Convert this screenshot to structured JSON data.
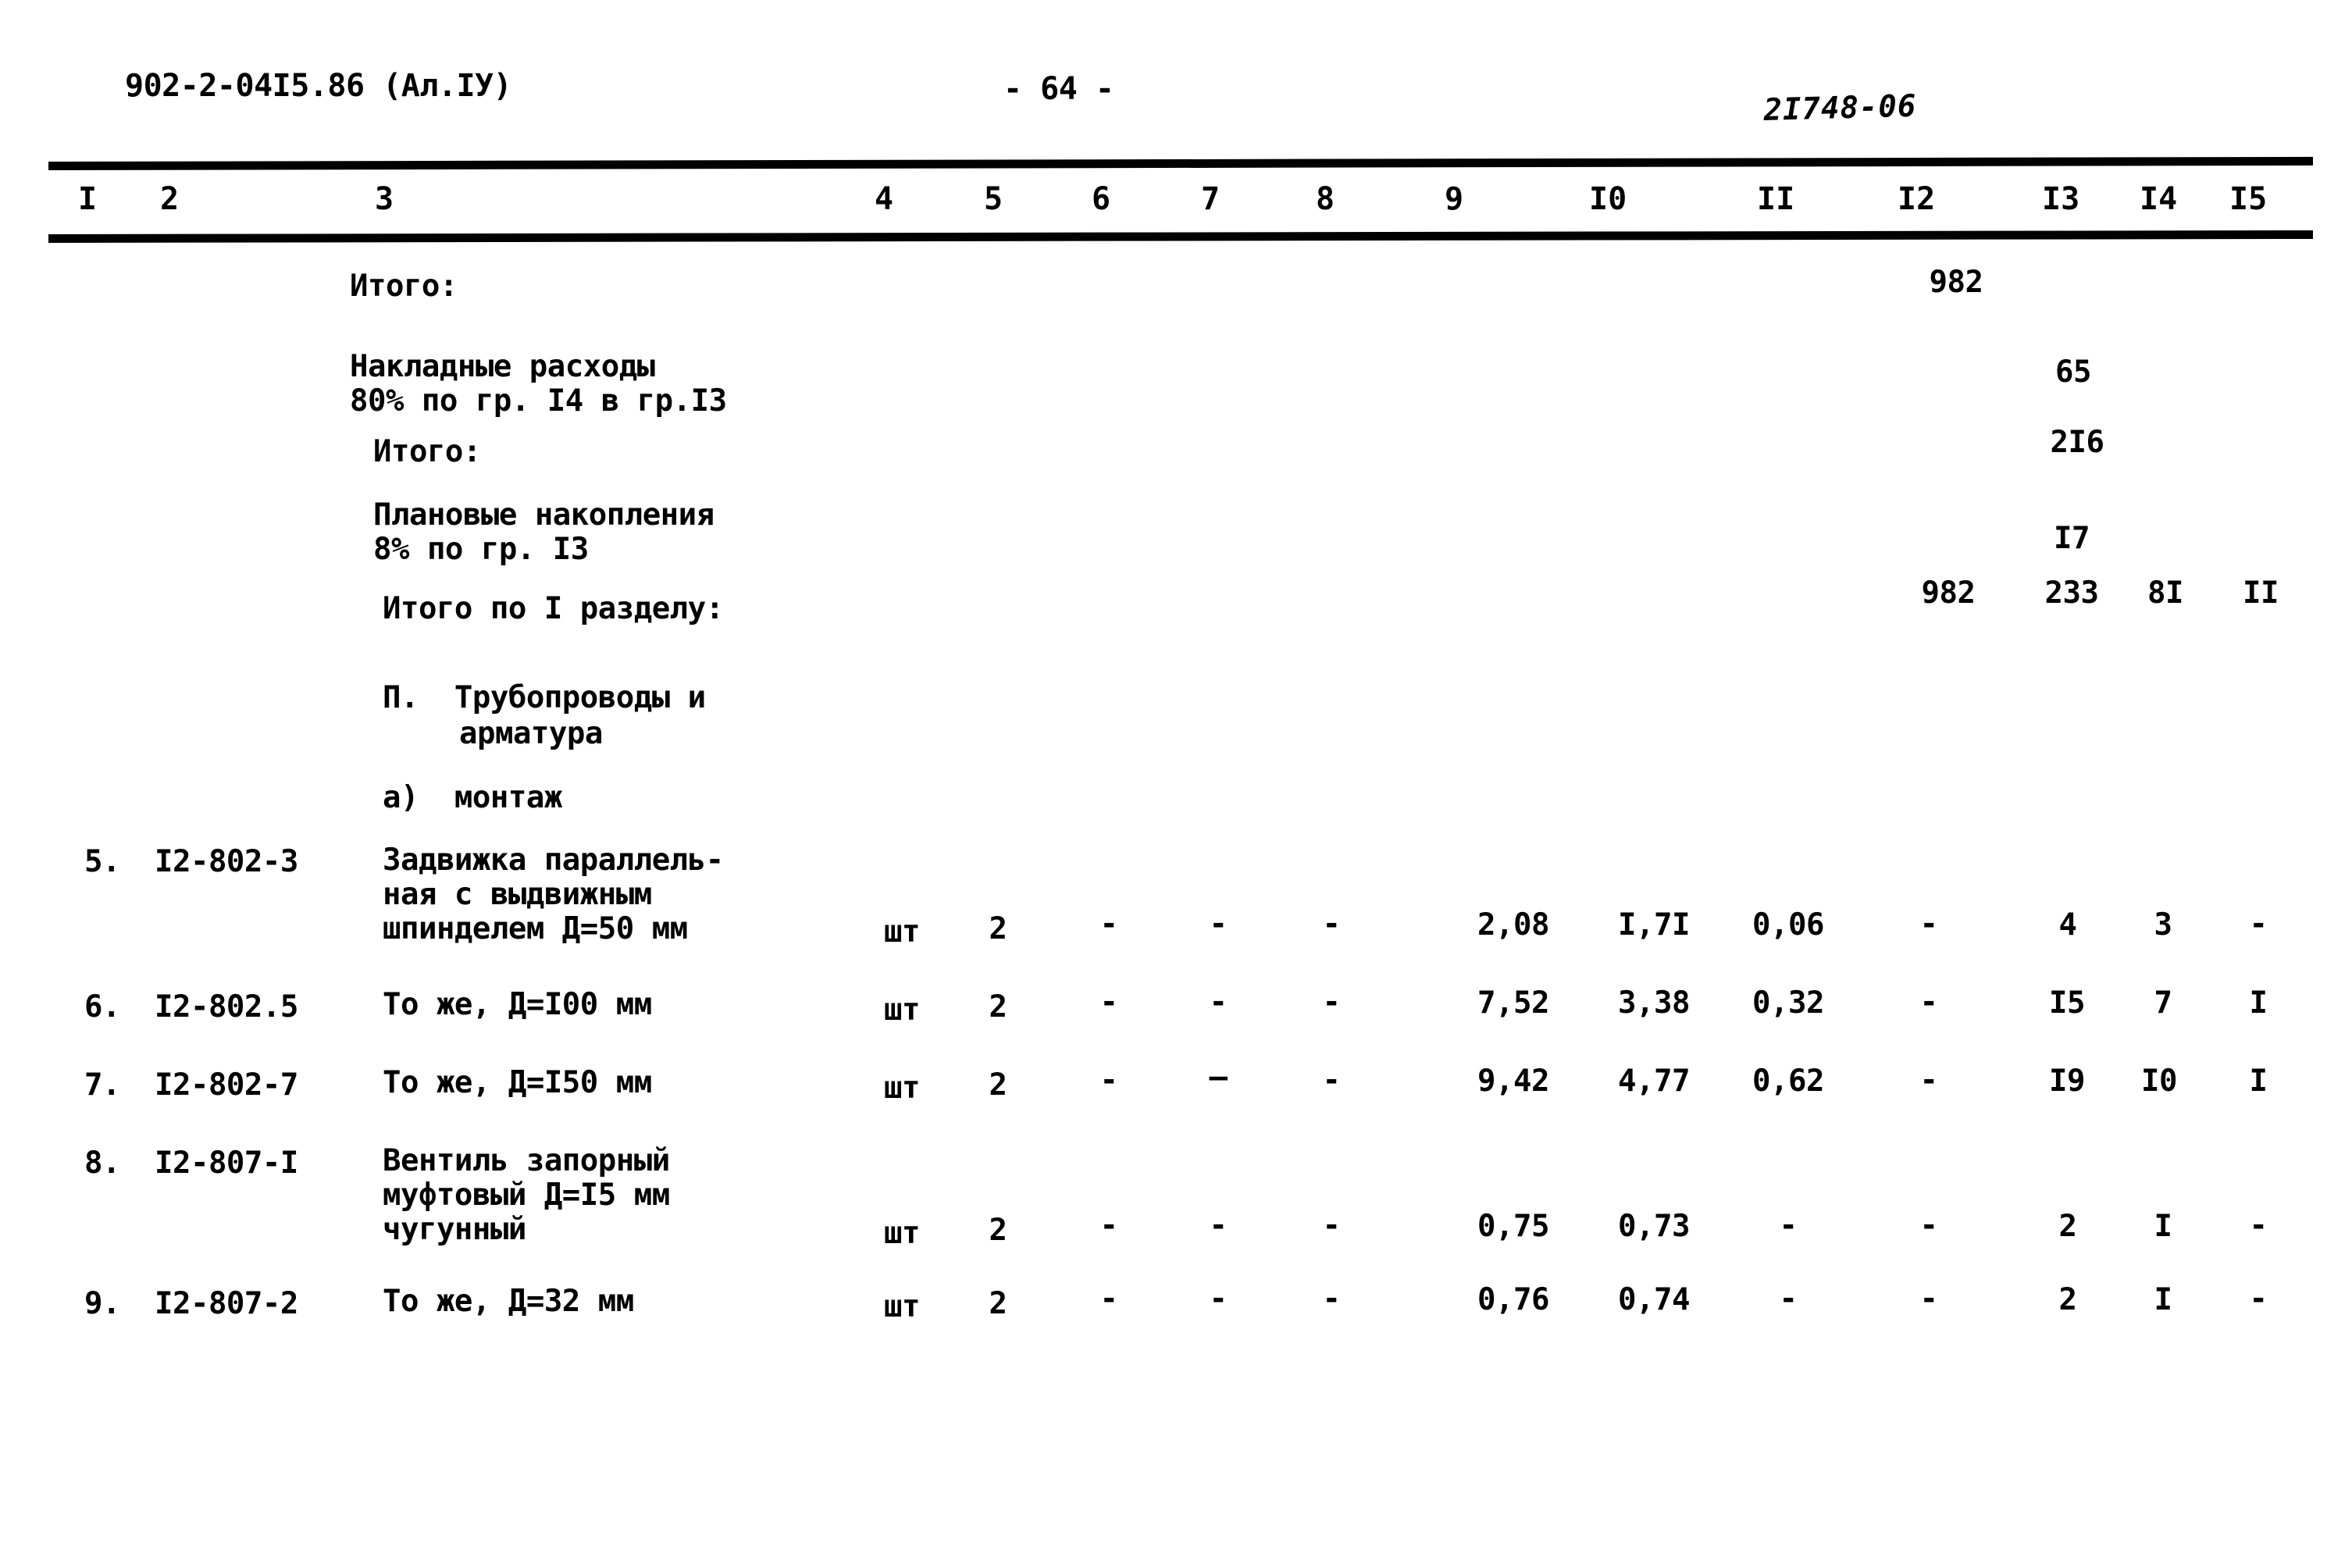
{
  "header": {
    "doc_code": "902-2-04I5.86 (Ал.IУ)",
    "page_number": "- 64 -",
    "stamp": "2I748-06"
  },
  "table": {
    "column_headers": [
      "I",
      "2",
      "3",
      "4",
      "5",
      "6",
      "7",
      "8",
      "9",
      "I0",
      "II",
      "I2",
      "I3",
      "I4",
      "I5"
    ],
    "summary_rows": [
      {
        "label": "Итого:",
        "col12": "982",
        "col13": "",
        "col14": "",
        "col15": ""
      },
      {
        "label": "Накладные расходы",
        "label2": "80% по гр. I4 в гр.I3",
        "col12": "",
        "col13": "65",
        "col14": "",
        "col15": ""
      },
      {
        "label": "Итого:",
        "col12": "",
        "col13": "2I6",
        "col14": "",
        "col15": ""
      },
      {
        "label": "Плановые накопления",
        "label2": "8% по гр. I3",
        "col12": "",
        "col13": "I7",
        "col14": "",
        "col15": ""
      },
      {
        "label": "Итого по I разделу:",
        "col12": "982",
        "col13": "233",
        "col14": "8I",
        "col15": "II"
      }
    ],
    "section_title_line1": "П.  Трубопроводы и",
    "section_title_line2": "арматура",
    "subsection_title": "а)  монтаж",
    "item_rows": [
      {
        "no": "5.",
        "code": "I2-802-3",
        "desc_lines": [
          "Задвижка параллель-",
          "ная с выдвижным",
          "шпинделем Д=50 мм"
        ],
        "c4": "шт",
        "c5": "2",
        "c6": "-",
        "c7": "-",
        "c8": "-",
        "c9": "2,08",
        "c10": "I,7I",
        "c11": "0,06",
        "c12": "-",
        "c13": "4",
        "c14": "3",
        "c15": "-"
      },
      {
        "no": "6.",
        "code": "I2-802.5",
        "desc_lines": [
          "То же, Д=I00 мм"
        ],
        "c4": "шт",
        "c5": "2",
        "c6": "-",
        "c7": "-",
        "c8": "-",
        "c9": "7,52",
        "c10": "3,38",
        "c11": "0,32",
        "c12": "-",
        "c13": "I5",
        "c14": "7",
        "c15": "I"
      },
      {
        "no": "7.",
        "code": "I2-802-7",
        "desc_lines": [
          "То же, Д=I50 мм"
        ],
        "c4": "шт",
        "c5": "2",
        "c6": "-",
        "c7": "—",
        "c8": "-",
        "c9": "9,42",
        "c10": "4,77",
        "c11": "0,62",
        "c12": "-",
        "c13": "I9",
        "c14": "I0",
        "c15": "I"
      },
      {
        "no": "8.",
        "code": "I2-807-I",
        "desc_lines": [
          "Вентиль запорный",
          "муфтовый Д=I5 мм",
          "чугунный"
        ],
        "c4": "шт",
        "c5": "2",
        "c6": "-",
        "c7": "-",
        "c8": "-",
        "c9": "0,75",
        "c10": "0,73",
        "c11": "-",
        "c12": "-",
        "c13": "2",
        "c14": "I",
        "c15": "-"
      },
      {
        "no": "9.",
        "code": "I2-807-2",
        "desc_lines": [
          "То же, Д=32 мм"
        ],
        "c4": "шт",
        "c5": "2",
        "c6": "-",
        "c7": "-",
        "c8": "-",
        "c9": "0,76",
        "c10": "0,74",
        "c11": "-",
        "c12": "-",
        "c13": "2",
        "c14": "I",
        "c15": "-"
      }
    ]
  }
}
